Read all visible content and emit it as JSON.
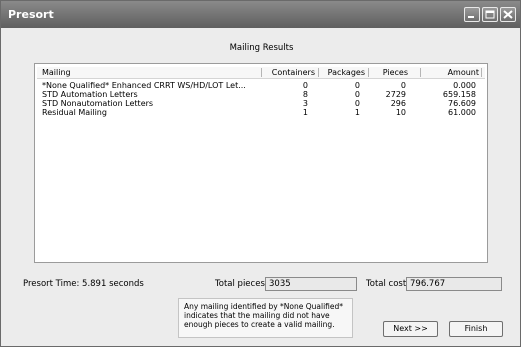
{
  "window": {
    "title": "Presort"
  },
  "heading": "Mailing Results",
  "columns": [
    "Mailing",
    "Containers",
    "Packages",
    "Pieces",
    "Amount"
  ],
  "rows": [
    {
      "mailing": "*None Qualified* Enhanced CRRT WS/HD/LOT Let...",
      "containers": "0",
      "packages": "0",
      "pieces": "0",
      "amount": "0.000"
    },
    {
      "mailing": "STD Automation Letters",
      "containers": "8",
      "packages": "0",
      "pieces": "2729",
      "amount": "659.158"
    },
    {
      "mailing": "STD Nonautomation Letters",
      "containers": "3",
      "packages": "0",
      "pieces": "296",
      "amount": "76.609"
    },
    {
      "mailing": "Residual Mailing",
      "containers": "1",
      "packages": "1",
      "pieces": "10",
      "amount": "61.000"
    }
  ],
  "presort_time": "Presort Time: 5.891 seconds",
  "total_pieces_label": "Total pieces",
  "total_pieces_value": "3035",
  "total_cost_label": "Total cost",
  "total_cost_value": "796.767",
  "note": "Any mailing identified by *None Qualified* indicates that the mailing did not have enough pieces to create a valid mailing.",
  "buttons": {
    "next": "Next >>",
    "finish": "Finish"
  }
}
